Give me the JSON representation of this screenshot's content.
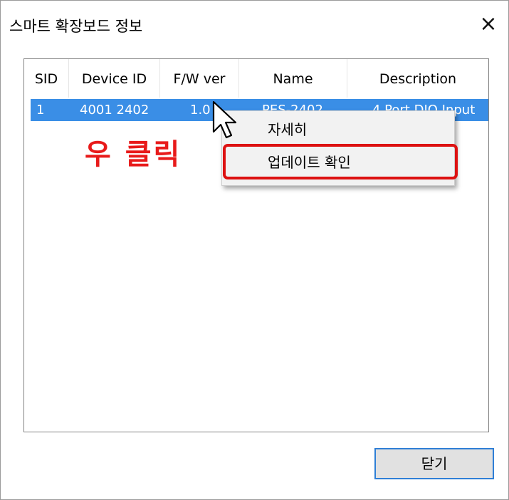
{
  "window": {
    "title": "스마트 확장보드 정보",
    "close_icon": "×"
  },
  "list": {
    "columns": [
      "SID",
      "Device ID",
      "F/W ver",
      "Name",
      "Description"
    ],
    "rows": [
      {
        "sid": "1",
        "device_id": "4001 2402",
        "fw_ver": "1.0",
        "name": "PES-2402",
        "description": "4 Port DIO Input"
      }
    ]
  },
  "annotation": {
    "text": "우 클릭",
    "color": "#e81a1a"
  },
  "context_menu": {
    "items": [
      "자세히",
      "업데이트 확인"
    ],
    "highlighted_item": "업데이트 확인"
  },
  "buttons": {
    "close_label": "닫기"
  },
  "colors": {
    "selection": "#3a8ee6",
    "highlight_border": "#dd1111",
    "button_border": "#2f7fd6"
  }
}
